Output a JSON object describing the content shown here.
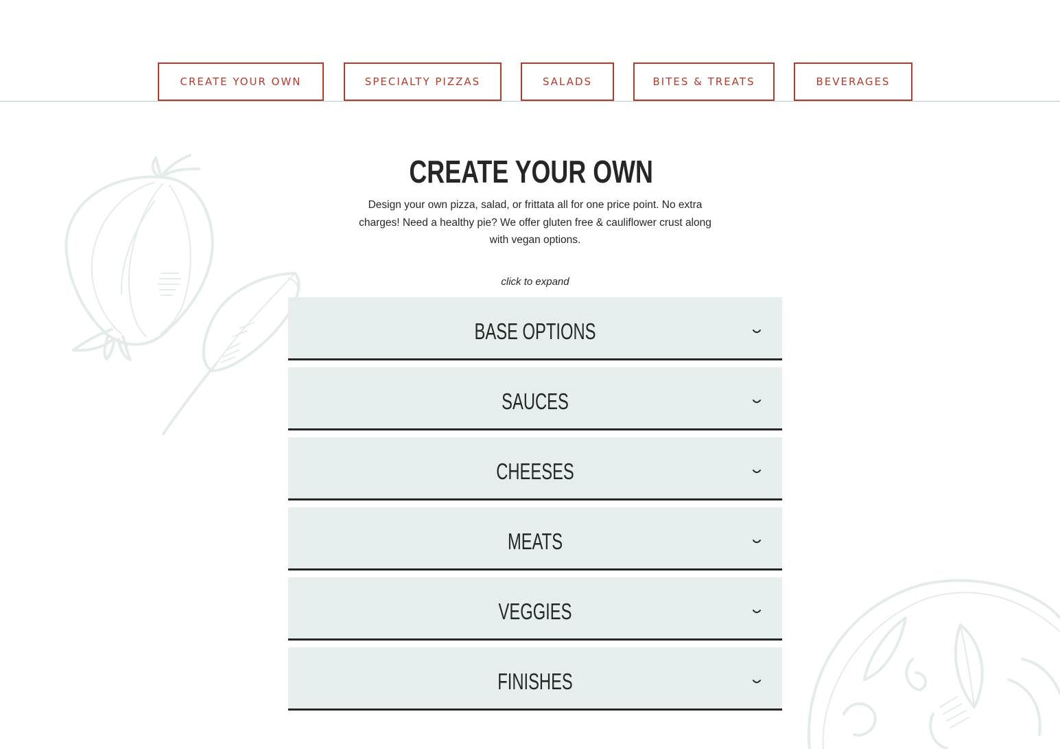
{
  "nav": {
    "items": [
      {
        "label": "CREATE YOUR OWN"
      },
      {
        "label": "SPECIALTY PIZZAS"
      },
      {
        "label": "SALADS"
      },
      {
        "label": "BITES & TREATS"
      },
      {
        "label": "BEVERAGES"
      }
    ]
  },
  "section": {
    "title": "CREATE YOUR OWN",
    "description": "Design your own pizza, salad, or frittata all for one price point. No extra charges! Need a healthy pie? We offer gluten free & cauliflower crust along with vegan options.",
    "hint": "click to expand"
  },
  "accordion": {
    "items": [
      {
        "label": "BASE OPTIONS",
        "icon": "chevron-down-icon"
      },
      {
        "label": "SAUCES",
        "icon": "chevron-down-icon"
      },
      {
        "label": "CHEESES",
        "icon": "chevron-down-icon"
      },
      {
        "label": "MEATS",
        "icon": "chevron-down-icon"
      },
      {
        "label": "VEGGIES",
        "icon": "chevron-down-icon"
      },
      {
        "label": "FINISHES",
        "icon": "chevron-down-icon"
      }
    ]
  },
  "colors": {
    "accent": "#b53a2b",
    "panel": "#e5eeed",
    "text": "#262626",
    "sketch": "#e3ecea"
  },
  "decorations": [
    "onion-sketch-icon",
    "leaf-sketch-icon",
    "pizza-sketch-icon"
  ]
}
